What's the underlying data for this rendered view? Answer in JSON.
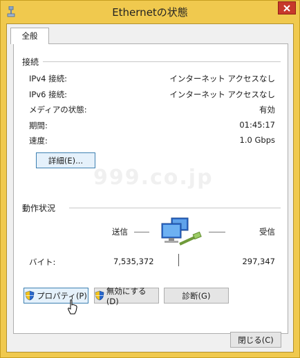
{
  "window": {
    "title": "Ethernetの状態"
  },
  "tabs": [
    {
      "label": "全般"
    }
  ],
  "connection": {
    "section_title": "接続",
    "rows": [
      {
        "label": "IPv4 接続:",
        "value": "インターネット アクセスなし"
      },
      {
        "label": "IPv6 接続:",
        "value": "インターネット アクセスなし"
      },
      {
        "label": "メディアの状態:",
        "value": "有効"
      },
      {
        "label": "期間:",
        "value": "01:45:17"
      },
      {
        "label": "速度:",
        "value": "1.0 Gbps"
      }
    ],
    "details_button": "詳細(E)..."
  },
  "watermark": "999.co.jp",
  "activity": {
    "section_title": "動作状況",
    "sent_label": "送信",
    "received_label": "受信",
    "bytes_label": "バイト:",
    "bytes_sent": "7,535,372",
    "bytes_received": "297,347"
  },
  "actions": {
    "properties": "プロパティ(P)",
    "disable": "無効にする(D)",
    "diagnose": "診断(G)"
  },
  "footer": {
    "close": "閉じる(C)"
  },
  "colors": {
    "title_bar": "#f0c94e",
    "close_button": "#c7392b",
    "shield_blue": "#2a67c9",
    "shield_yellow": "#f2c21b"
  }
}
